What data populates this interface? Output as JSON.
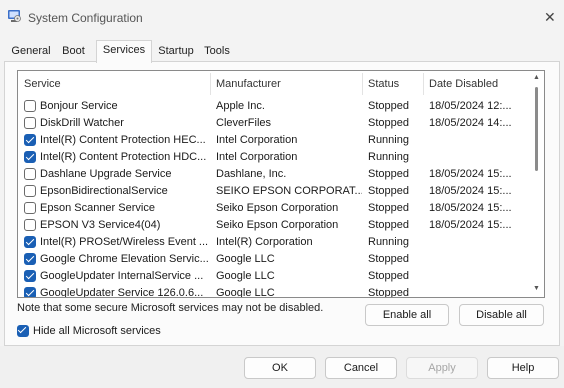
{
  "window": {
    "title": "System Configuration",
    "close_glyph": "✕"
  },
  "tabs": [
    {
      "label": "General"
    },
    {
      "label": "Boot"
    },
    {
      "label": "Services"
    },
    {
      "label": "Startup"
    },
    {
      "label": "Tools"
    }
  ],
  "active_tab": "Services",
  "columns": {
    "service": "Service",
    "manufacturer": "Manufacturer",
    "status": "Status",
    "date_disabled": "Date Disabled"
  },
  "services": [
    {
      "name": "Bonjour Service",
      "manufacturer": "Apple Inc.",
      "status": "Stopped",
      "date_disabled": "18/05/2024 12:...",
      "checked": false
    },
    {
      "name": "DiskDrill Watcher",
      "manufacturer": "CleverFiles",
      "status": "Stopped",
      "date_disabled": "18/05/2024 14:...",
      "checked": false
    },
    {
      "name": "Intel(R) Content Protection HEC...",
      "manufacturer": "Intel Corporation",
      "status": "Running",
      "date_disabled": "",
      "checked": true
    },
    {
      "name": "Intel(R) Content Protection HDC...",
      "manufacturer": "Intel Corporation",
      "status": "Running",
      "date_disabled": "",
      "checked": true
    },
    {
      "name": "Dashlane Upgrade Service",
      "manufacturer": "Dashlane, Inc.",
      "status": "Stopped",
      "date_disabled": "18/05/2024 15:...",
      "checked": false
    },
    {
      "name": "EpsonBidirectionalService",
      "manufacturer": "SEIKO EPSON CORPORAT...",
      "status": "Stopped",
      "date_disabled": "18/05/2024 15:...",
      "checked": false
    },
    {
      "name": "Epson Scanner Service",
      "manufacturer": "Seiko Epson Corporation",
      "status": "Stopped",
      "date_disabled": "18/05/2024 15:...",
      "checked": false
    },
    {
      "name": "EPSON V3 Service4(04)",
      "manufacturer": "Seiko Epson Corporation",
      "status": "Stopped",
      "date_disabled": "18/05/2024 15:...",
      "checked": false
    },
    {
      "name": "Intel(R) PROSet/Wireless Event ...",
      "manufacturer": "Intel(R) Corporation",
      "status": "Running",
      "date_disabled": "",
      "checked": true
    },
    {
      "name": "Google Chrome Elevation Servic...",
      "manufacturer": "Google LLC",
      "status": "Stopped",
      "date_disabled": "",
      "checked": true
    },
    {
      "name": "GoogleUpdater InternalService ...",
      "manufacturer": "Google LLC",
      "status": "Stopped",
      "date_disabled": "",
      "checked": true
    },
    {
      "name": "GoogleUpdater Service 126.0.6...",
      "manufacturer": "Google LLC",
      "status": "Stopped",
      "date_disabled": "",
      "checked": true
    }
  ],
  "note": "Note that some secure Microsoft services may not be disabled.",
  "enable_all_label": "Enable all",
  "disable_all_label": "Disable all",
  "hide_microsoft_label": "Hide all Microsoft services",
  "hide_microsoft_checked": true,
  "buttons": {
    "ok": "OK",
    "cancel": "Cancel",
    "apply": "Apply",
    "help": "Help"
  },
  "apply_enabled": false,
  "colors": {
    "accent": "#1a5fb4"
  }
}
